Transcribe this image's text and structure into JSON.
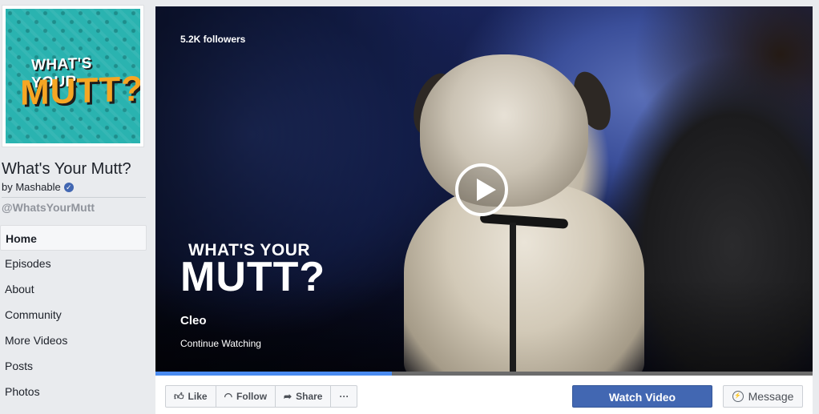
{
  "sidebar": {
    "profile_logo_line1": "WHAT'S YOUR",
    "profile_logo_line2": "MUTT?",
    "page_name": "What's Your Mutt?",
    "byline": "by Mashable",
    "handle": "@WhatsYourMutt",
    "nav": [
      "Home",
      "Episodes",
      "About",
      "Community",
      "More Videos",
      "Posts",
      "Photos"
    ],
    "active_nav": "Home"
  },
  "video": {
    "followers": "5.2K followers",
    "logo_line1": "WHAT'S YOUR",
    "logo_line2": "MUTT?",
    "episode_title": "Cleo",
    "continue_label": "Continue Watching",
    "progress": 0.36
  },
  "actions": {
    "like": "Like",
    "follow": "Follow",
    "share": "Share",
    "more": "···",
    "watch_video": "Watch Video",
    "message": "Message"
  },
  "colors": {
    "accent": "#4267b2",
    "progress": "#4a8bf0",
    "background": "#e9ebee"
  },
  "icons": [
    "verified-icon",
    "like-icon",
    "follow-icon",
    "share-icon",
    "more-icon",
    "message-icon",
    "play-icon"
  ]
}
